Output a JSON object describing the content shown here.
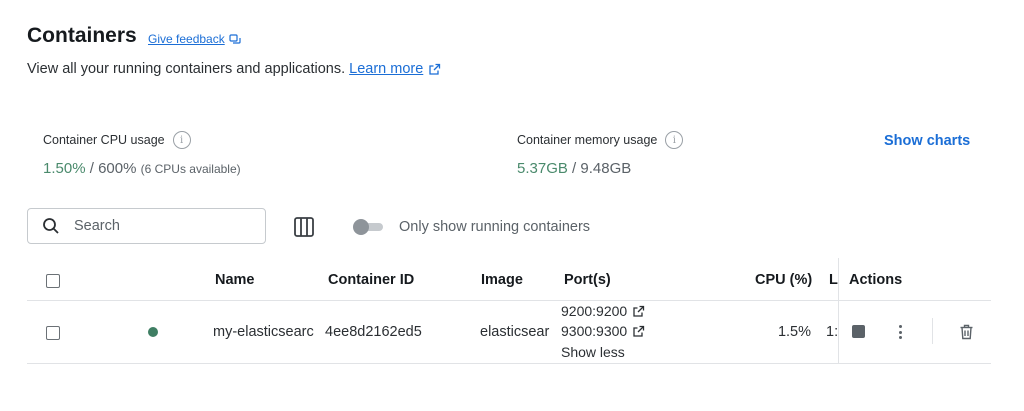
{
  "header": {
    "title": "Containers",
    "feedback_label": "Give feedback",
    "subtitle": "View all your running containers and applications.",
    "learn_more": "Learn more"
  },
  "stats": {
    "cpu": {
      "label": "Container CPU usage",
      "used": "1.50%",
      "separator": " / ",
      "total": "600%",
      "note": "(6 CPUs available)"
    },
    "memory": {
      "label": "Container memory usage",
      "used": "5.37GB",
      "separator": " / ",
      "total": "9.48GB"
    },
    "show_charts": "Show charts"
  },
  "toolbar": {
    "search_placeholder": "Search",
    "toggle_label": "Only show running containers",
    "only_running": false
  },
  "table": {
    "columns": {
      "name": "Name",
      "container_id": "Container ID",
      "image": "Image",
      "ports": "Port(s)",
      "cpu": "CPU (%)",
      "last_started": "L",
      "actions": "Actions"
    },
    "rows": [
      {
        "name": "my-elasticsearc",
        "container_id": "4ee8d2162ed5",
        "image": "elasticsear",
        "ports": [
          "9200:9200",
          "9300:9300"
        ],
        "ports_toggle": "Show less",
        "cpu": "1.5%",
        "last_started": "1:",
        "status": "running"
      }
    ]
  },
  "colors": {
    "accent": "#1b6ed6",
    "running": "#3f7e63",
    "stat_green": "#4a8a6c"
  }
}
